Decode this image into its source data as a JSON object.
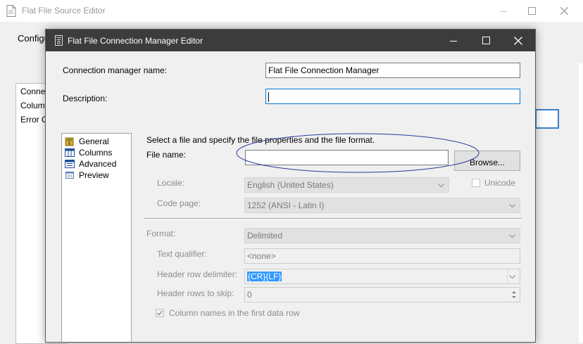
{
  "background_window": {
    "title": "Flat File Source Editor",
    "config_label": "Configu",
    "list_items": [
      "Conne",
      "Colum",
      "Error O"
    ]
  },
  "dialog": {
    "title": "Flat File Connection Manager Editor",
    "connection_manager_name_label": "Connection manager name:",
    "connection_manager_name_value": "Flat File Connection Manager",
    "description_label": "Description:",
    "description_value": "",
    "nav_items": [
      {
        "label": "General",
        "icon": "general-icon"
      },
      {
        "label": "Columns",
        "icon": "columns-icon"
      },
      {
        "label": "Advanced",
        "icon": "advanced-icon"
      },
      {
        "label": "Preview",
        "icon": "preview-icon"
      }
    ],
    "instruction": "Select a file and specify the file properties and the file format.",
    "file_name_label": "File name:",
    "file_name_value": "",
    "browse_label": "Browse...",
    "locale_label": "Locale:",
    "locale_value": "English (United States)",
    "unicode_label": "Unicode",
    "code_page_label": "Code page:",
    "code_page_value": "1252  (ANSI - Latin I)",
    "format_label": "Format:",
    "format_value": "Delimited",
    "text_qualifier_label": "Text qualifier:",
    "text_qualifier_value": "<none>",
    "header_row_delimiter_label": "Header row delimiter:",
    "header_row_delimiter_value": "{CR}{LF}",
    "header_rows_skip_label": "Header rows to skip:",
    "header_rows_skip_value": "0",
    "column_names_label": "Column names in the first data row",
    "column_names_checked": true
  },
  "colors": {
    "title_bar": "#3c3c3c",
    "focus_border": "#0078d7",
    "annotation_oval": "#2b3a9e",
    "selection": "#3399ff"
  }
}
